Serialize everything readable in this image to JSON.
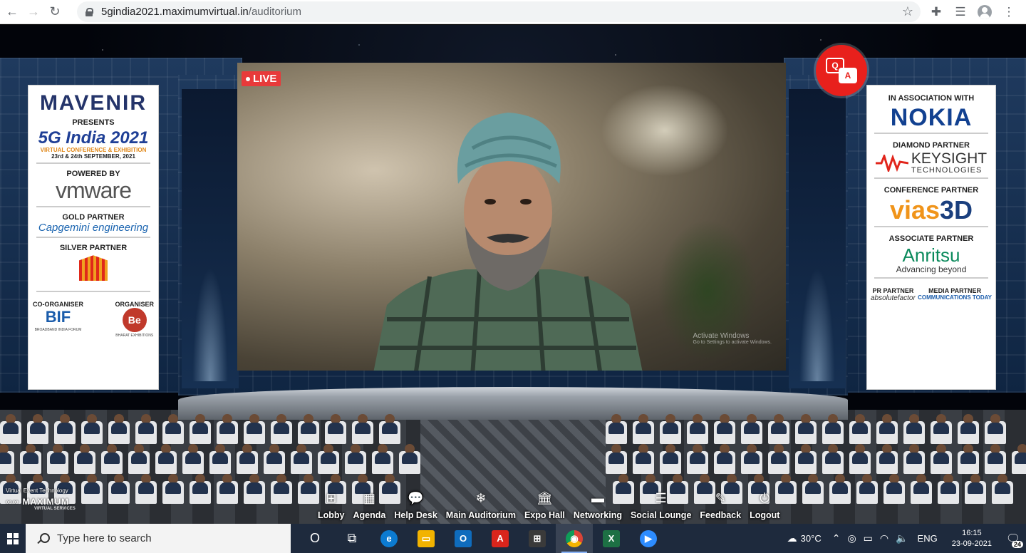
{
  "browser": {
    "url_host": "5gindia2021.maximumvirtual.in",
    "url_path": "/auditorium",
    "icons": [
      "back-arrow-icon",
      "forward-arrow-icon",
      "reload-icon",
      "lock-icon",
      "star-icon",
      "extensions-icon",
      "reading-list-icon",
      "profile-icon",
      "menu-icon"
    ]
  },
  "left_banner": {
    "mavenir": "MAVENIR",
    "presents": "PRESENTS",
    "event_title": "5G India 2021",
    "event_sub": "VIRTUAL CONFERENCE & EXHIBITION",
    "event_dates": "23rd & 24th SEPTEMBER, 2021",
    "powered_by": "POWERED BY",
    "vmware": "vmware",
    "gold_partner": "GOLD PARTNER",
    "capgemini": "Capgemini engineering",
    "silver_partner": "SILVER PARTNER",
    "co_organiser": "CO-ORGANISER",
    "bif": "BIF",
    "bif_sub": "BROADBAND INDIA FORUM",
    "organiser": "ORGANISER",
    "be_logo": "Be",
    "be_sub": "BHARAT EXHIBITIONS"
  },
  "right_banner": {
    "association": "IN ASSOCIATION WITH",
    "nokia": "NOKIA",
    "diamond_partner": "DIAMOND PARTNER",
    "keysight": "KEYSIGHT",
    "keysight_sub": "TECHNOLOGIES",
    "conference_partner": "CONFERENCE PARTNER",
    "vias": "vias",
    "vias_3d": "3D",
    "associate_partner": "ASSOCIATE PARTNER",
    "anritsu": "Anritsu",
    "anritsu_sub": "Advancing beyond",
    "pr_partner": "PR PARTNER",
    "absolute": "absolutefactor",
    "media_partner": "MEDIA PARTNER",
    "comms_today": "COMMUNICATIONS TODAY"
  },
  "video": {
    "live_label": "LIVE",
    "activate_title": "Activate Windows",
    "activate_sub": "Go to Settings to activate Windows."
  },
  "qa_button": {
    "q": "Q",
    "a": "A"
  },
  "brand": {
    "line1": "Virtual Event Technology",
    "line2": "MAXIMUM",
    "line3": "VIRTUAL SERVICES"
  },
  "nav": [
    {
      "label": "Lobby",
      "icon": "⊞"
    },
    {
      "label": "Agenda",
      "icon": "▦"
    },
    {
      "label": "Help Desk",
      "icon": "💬"
    },
    {
      "label": "Main Auditorium",
      "icon": "❄"
    },
    {
      "label": "Expo Hall",
      "icon": "🏛"
    },
    {
      "label": "Networking",
      "icon": "▬"
    },
    {
      "label": "Social Lounge",
      "icon": "☰"
    },
    {
      "label": "Feedback",
      "icon": "✎"
    },
    {
      "label": "Logout",
      "icon": "⏻"
    }
  ],
  "taskbar": {
    "search_placeholder": "Type here to search",
    "apps": [
      {
        "name": "cortana",
        "label": "O",
        "color": "transparent"
      },
      {
        "name": "task-view",
        "label": "⧉",
        "color": "transparent"
      },
      {
        "name": "edge",
        "label": "e",
        "color": "#0c7bd1"
      },
      {
        "name": "file-explorer",
        "label": "▭",
        "color": "#f2b300"
      },
      {
        "name": "outlook",
        "label": "O",
        "color": "#0f6cbd"
      },
      {
        "name": "acrobat",
        "label": "A",
        "color": "#d9251c"
      },
      {
        "name": "store",
        "label": "⊞",
        "color": "#3a3a3a"
      },
      {
        "name": "chrome",
        "label": "◉",
        "color": "#db4437"
      },
      {
        "name": "excel",
        "label": "X",
        "color": "#1d7044"
      },
      {
        "name": "zoom",
        "label": "▶",
        "color": "#2d8cff"
      }
    ],
    "weather": "30°C",
    "lang": "ENG",
    "time": "16:15",
    "date": "23-09-2021",
    "notifications": "24"
  }
}
